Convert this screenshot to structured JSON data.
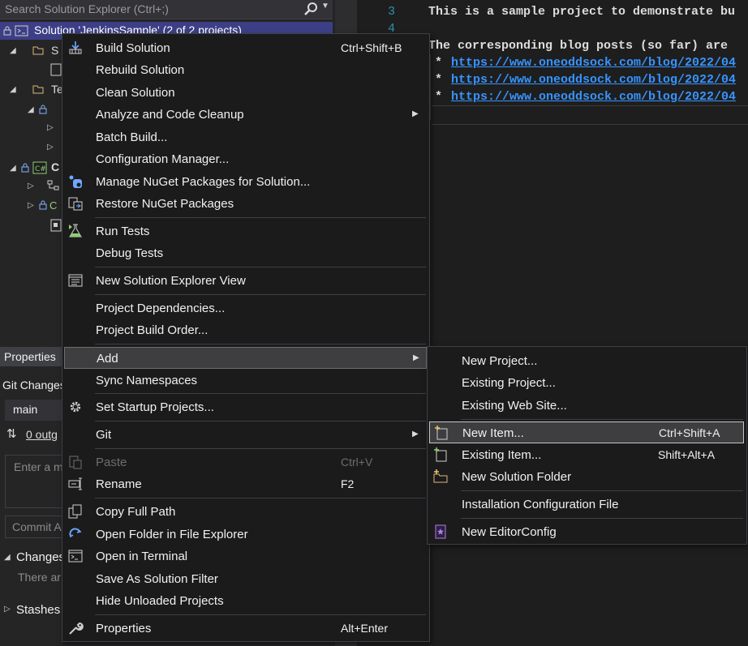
{
  "solution_explorer": {
    "search_placeholder": "Search Solution Explorer (Ctrl+;)",
    "solution_label": "Solution 'JenkinsSample' (2 of 2 projects)",
    "tree_fragments": [
      "S",
      "Te",
      "C"
    ]
  },
  "editor": {
    "lines": [
      {
        "num": "3",
        "text": "This is a sample project to demonstrate bu"
      },
      {
        "num": "4",
        "text": ""
      },
      {
        "num": "",
        "text": "The corresponding blog posts (so far) are"
      }
    ],
    "links": [
      "https://www.oneoddsock.com/blog/2022/04",
      "https://www.oneoddsock.com/blog/2022/04",
      "https://www.oneoddsock.com/blog/2022/04"
    ],
    "bullet": "*"
  },
  "bottom_panels": {
    "properties_tab": "Properties",
    "git_changes_tab": "Git Changes",
    "branch": "main",
    "outgoing": "0 outg",
    "commit_message_placeholder": "Enter a m",
    "commit_button": "Commit A",
    "changes_label": "Changes",
    "changes_info": "There ar",
    "stashes_label": "Stashes"
  },
  "context_menu": {
    "items": [
      {
        "label": "Build Solution",
        "shortcut": "Ctrl+Shift+B",
        "icon": "build-icon"
      },
      {
        "label": "Rebuild Solution"
      },
      {
        "label": "Clean Solution"
      },
      {
        "label": "Analyze and Code Cleanup",
        "submenu": true
      },
      {
        "label": "Batch Build..."
      },
      {
        "label": "Configuration Manager..."
      },
      {
        "label": "Manage NuGet Packages for Solution...",
        "icon": "nuget-icon"
      },
      {
        "label": "Restore NuGet Packages",
        "icon": "restore-icon"
      },
      {
        "label": "Run Tests",
        "icon": "run-tests-icon"
      },
      {
        "label": "Debug Tests"
      },
      {
        "label": "New Solution Explorer View",
        "icon": "new-view-icon"
      },
      {
        "label": "Project Dependencies..."
      },
      {
        "label": "Project Build Order..."
      },
      {
        "label": "Add",
        "submenu": true
      },
      {
        "label": "Sync Namespaces"
      },
      {
        "label": "Set Startup Projects...",
        "icon": "gear-icon"
      },
      {
        "label": "Git",
        "submenu": true
      },
      {
        "label": "Paste",
        "shortcut": "Ctrl+V",
        "icon": "paste-icon",
        "disabled": true
      },
      {
        "label": "Rename",
        "shortcut": "F2",
        "icon": "rename-icon"
      },
      {
        "label": "Copy Full Path",
        "icon": "copy-icon"
      },
      {
        "label": "Open Folder in File Explorer",
        "icon": "refresh-folder-icon"
      },
      {
        "label": "Open in Terminal",
        "icon": "terminal-icon"
      },
      {
        "label": "Save As Solution Filter"
      },
      {
        "label": "Hide Unloaded Projects"
      },
      {
        "label": "Properties",
        "shortcut": "Alt+Enter",
        "icon": "wrench-icon"
      }
    ]
  },
  "add_submenu": {
    "items": [
      {
        "label": "New Project..."
      },
      {
        "label": "Existing Project..."
      },
      {
        "label": "Existing Web Site..."
      },
      {
        "label": "New Item...",
        "shortcut": "Ctrl+Shift+A",
        "icon": "new-item-icon"
      },
      {
        "label": "Existing Item...",
        "shortcut": "Shift+Alt+A",
        "icon": "existing-item-icon"
      },
      {
        "label": "New Solution Folder",
        "icon": "new-folder-icon"
      },
      {
        "label": "Installation Configuration File"
      },
      {
        "label": "New EditorConfig",
        "icon": "editorconfig-icon"
      }
    ]
  },
  "colors": {
    "menu_bg": "#1b1b1c",
    "solution_row": "#3c3f86",
    "link": "#3794ff",
    "line_number": "#2b91af"
  }
}
